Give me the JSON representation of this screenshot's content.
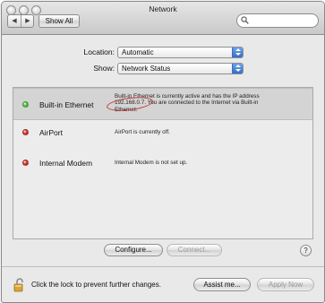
{
  "window": {
    "title": "Network"
  },
  "toolbar": {
    "back_glyph": "◀",
    "forward_glyph": "▶",
    "show_all_label": "Show All",
    "search_placeholder": ""
  },
  "controls": {
    "location_label": "Location:",
    "location_value": "Automatic",
    "show_label": "Show:",
    "show_value": "Network Status"
  },
  "services": [
    {
      "name": "Built-in Ethernet",
      "status_color": "#4fbf3c",
      "status_lines": [
        "Built-in Ethernet is currently active and has the IP address",
        "192.168.0.7. You are connected to the Internet via Built-in",
        "Ethernet."
      ]
    },
    {
      "name": "AirPort",
      "status_color": "#d0302c",
      "status_lines": [
        "AirPort is currently off."
      ]
    },
    {
      "name": "Internal Modem",
      "status_color": "#d0302c",
      "status_lines": [
        "Internal Modem is not set up."
      ]
    }
  ],
  "panel_buttons": {
    "configure_label": "Configure...",
    "connect_label": "Connect...",
    "help_label": "?"
  },
  "footer": {
    "lock_text": "Click the lock to prevent further changes.",
    "assist_label": "Assist me...",
    "apply_label": "Apply Now"
  },
  "colors": {
    "active_green": "#4fbf3c",
    "inactive_red": "#d0302c",
    "annotation_red": "#c43a3a",
    "popup_blue": "#2f6fd0"
  }
}
